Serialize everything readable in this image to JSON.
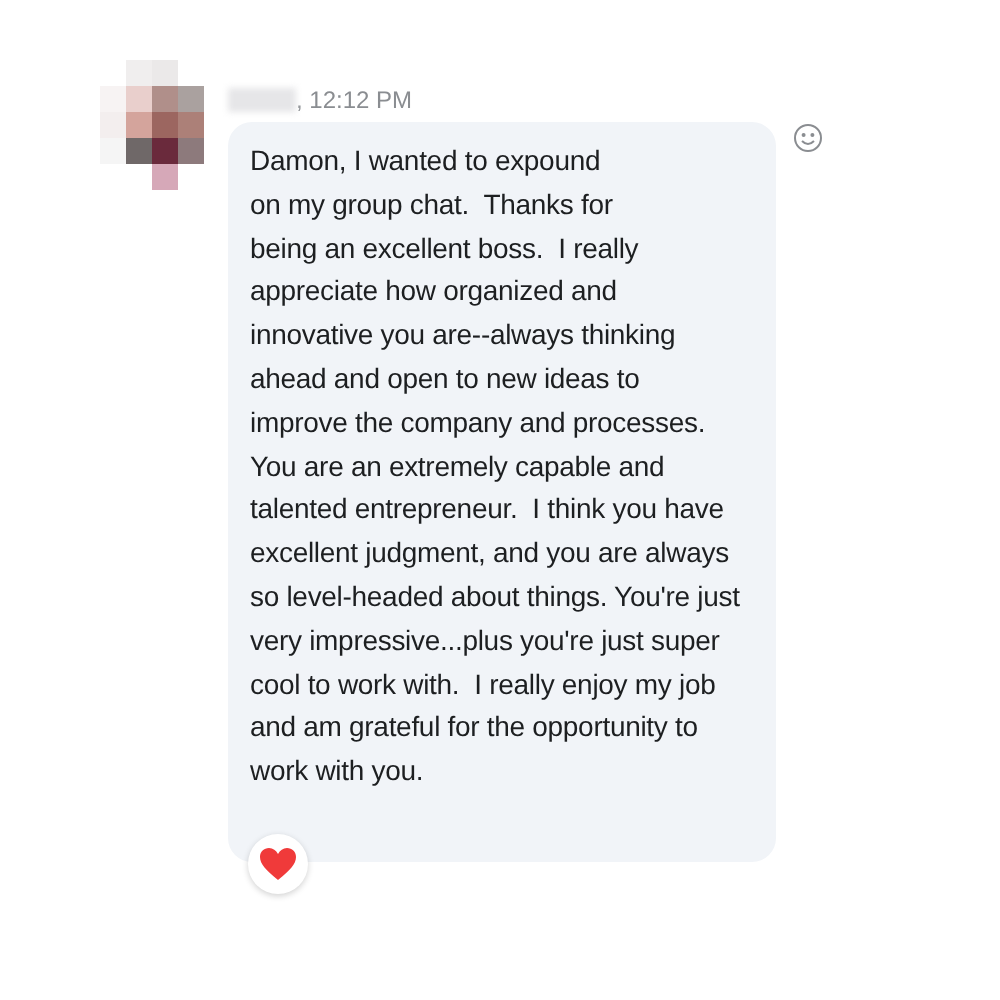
{
  "message": {
    "time": ", 12:12 PM",
    "lines": [
      "Damon, I wanted to expound",
      "on my group chat.  Thanks for",
      "being an excellent boss.  I really",
      "appreciate how organized and",
      "innovative you are--always thinking",
      "ahead and open to new ideas to",
      "improve the company and processes.",
      "You are an extremely capable and",
      "talented entrepreneur.  I think you have",
      "excellent judgment, and you are always",
      "so level-headed about things. You're just",
      "very impressive...plus you're just super",
      "cool to work with.  I really enjoy my job",
      "and am grateful for the opportunity to",
      "work with you."
    ],
    "reaction": {
      "kind": "heart"
    }
  }
}
